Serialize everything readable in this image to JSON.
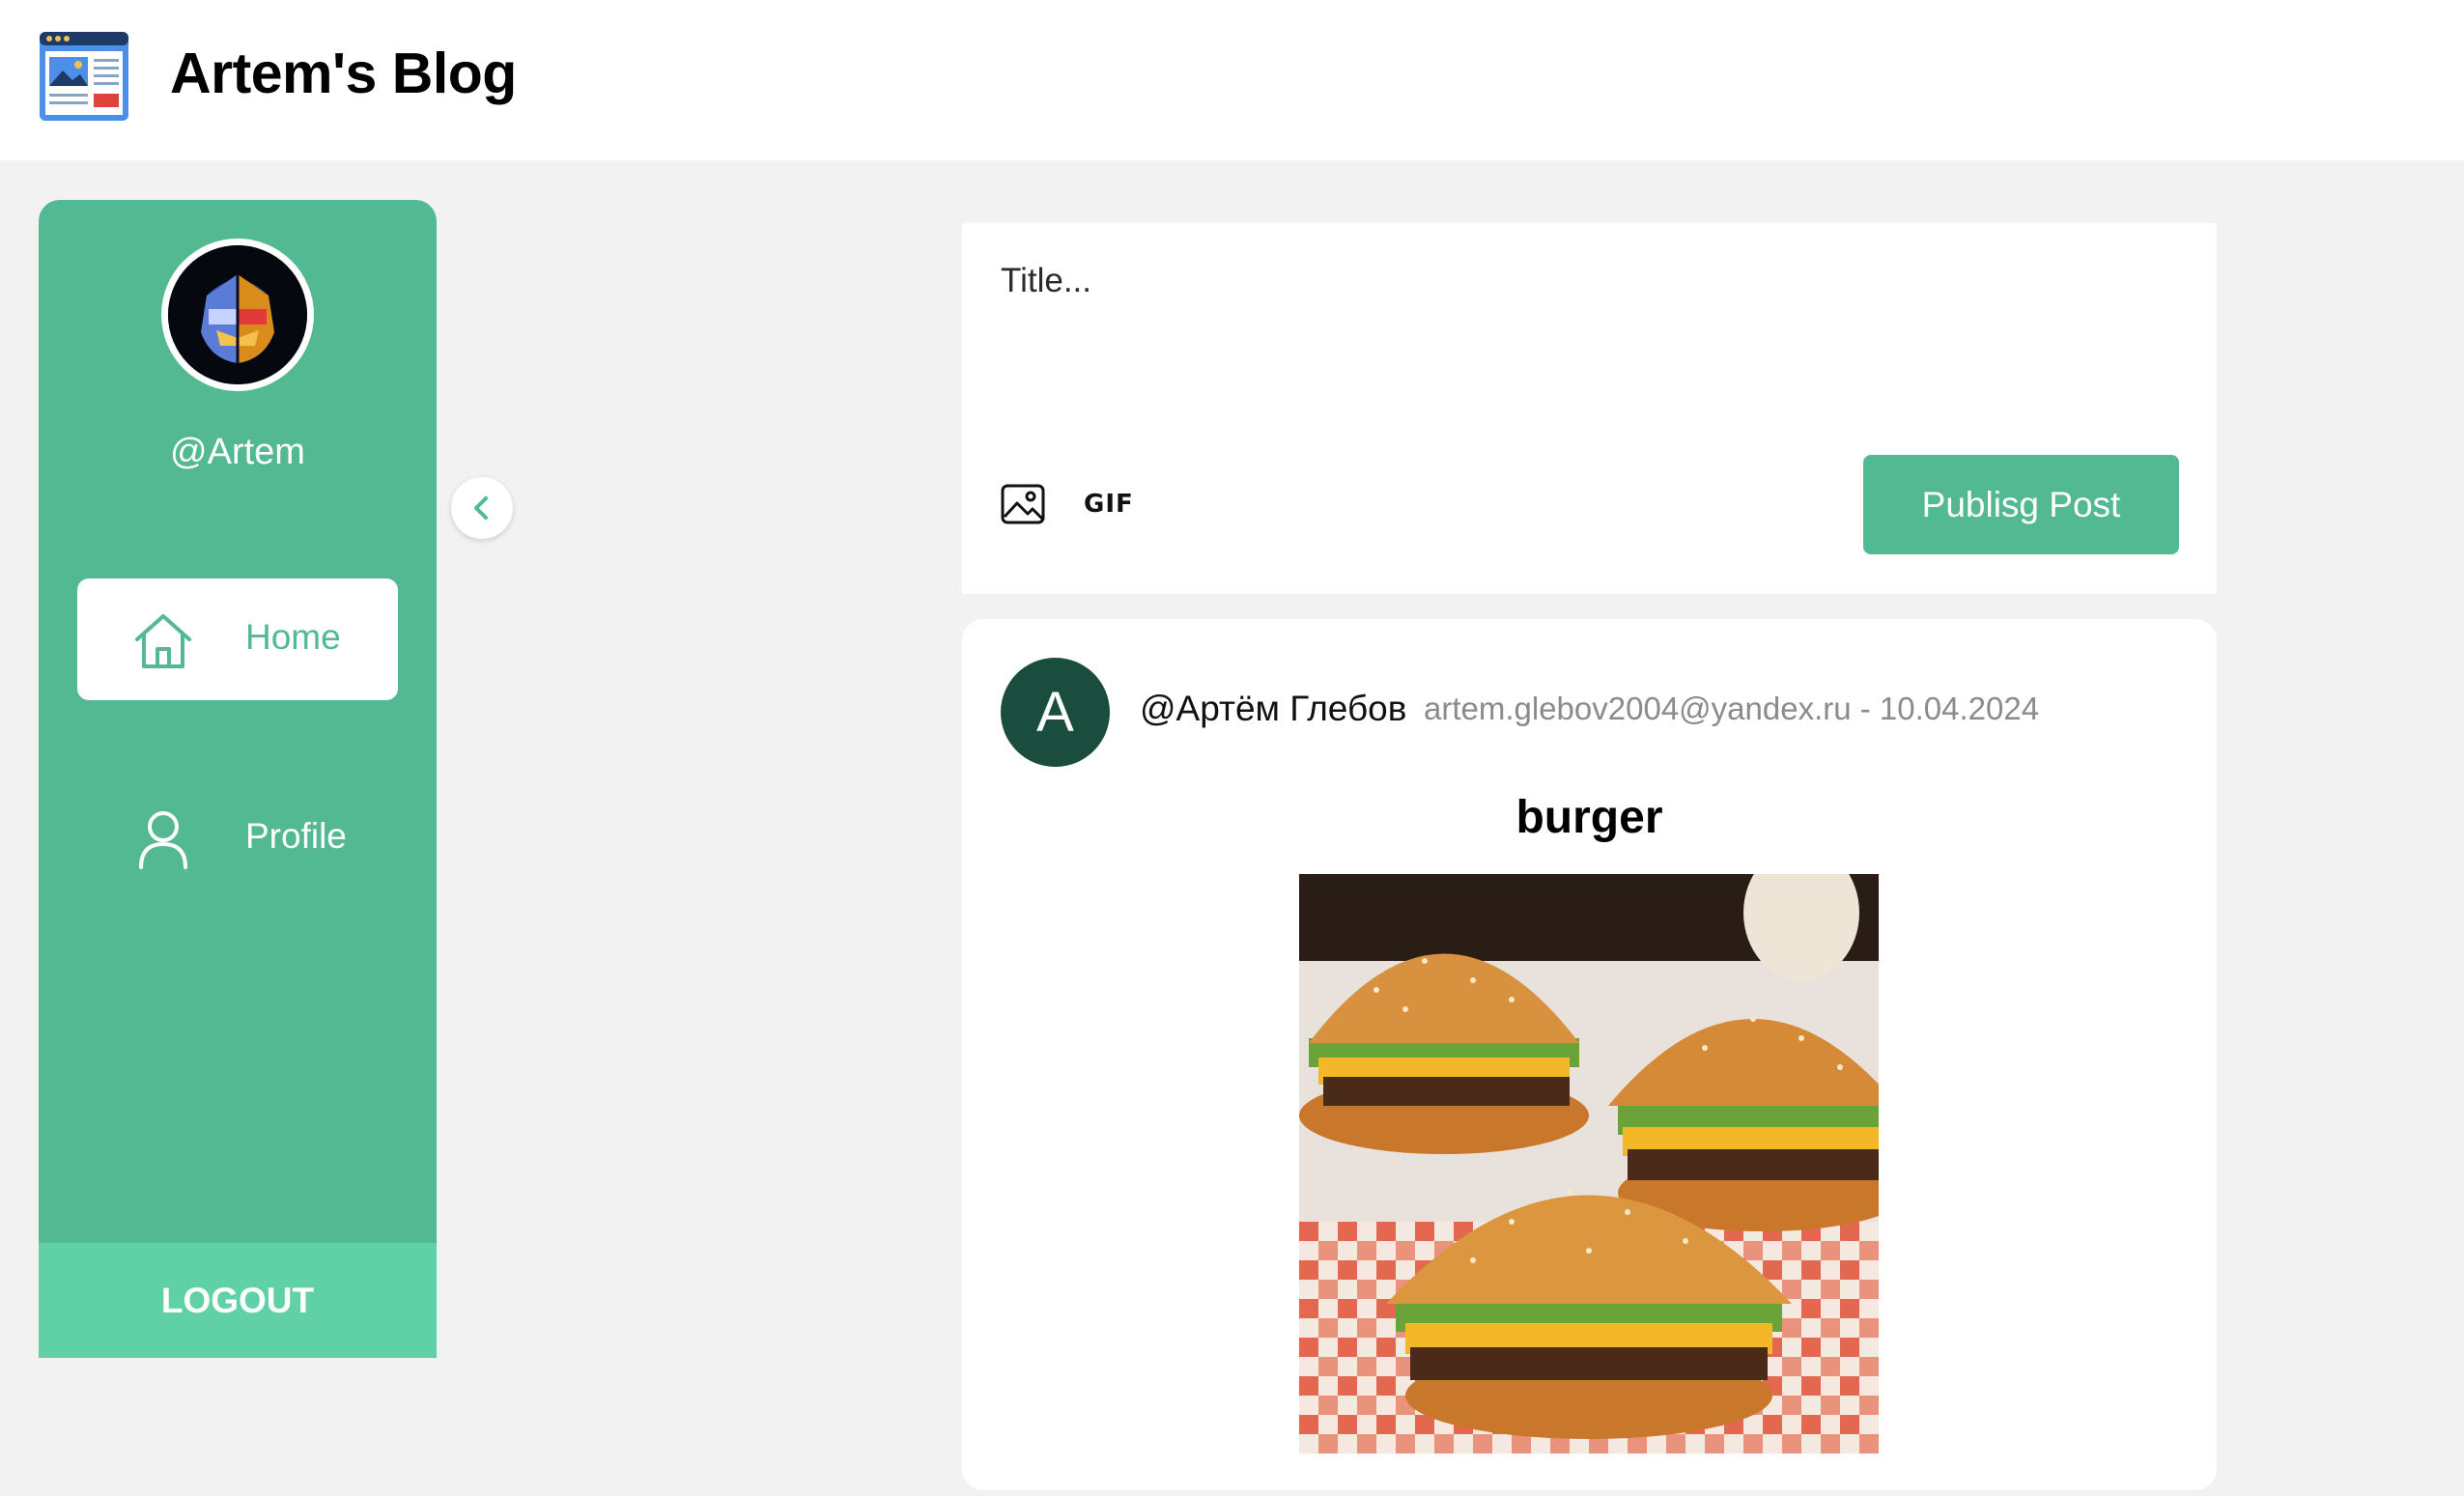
{
  "header": {
    "app_title": "Artem's Blog",
    "logo_icon": "blog-window-icon"
  },
  "sidebar": {
    "username": "@Artem",
    "avatar_icon": "helmet-avatar-icon",
    "collapse_icon": "chevron-left-icon",
    "nav": [
      {
        "label": "Home",
        "icon": "home-icon",
        "active": true
      },
      {
        "label": "Profile",
        "icon": "user-icon",
        "active": false
      }
    ],
    "logout_label": "LOGOUT"
  },
  "composer": {
    "title_placeholder": "Title...",
    "image_icon": "image-icon",
    "gif_label": "GIF",
    "publish_label": "Publisg Post"
  },
  "post": {
    "avatar_letter": "A",
    "author": "@Артём Глебов",
    "meta": "artem.glebov2004@yandex.ru - 10.04.2024",
    "title": "burger",
    "image_icon": "burger-photo"
  },
  "colors": {
    "accent": "#53b993",
    "logout": "#60d0a6",
    "post_avatar": "#1b4d3e",
    "background": "#f2f2f2"
  }
}
